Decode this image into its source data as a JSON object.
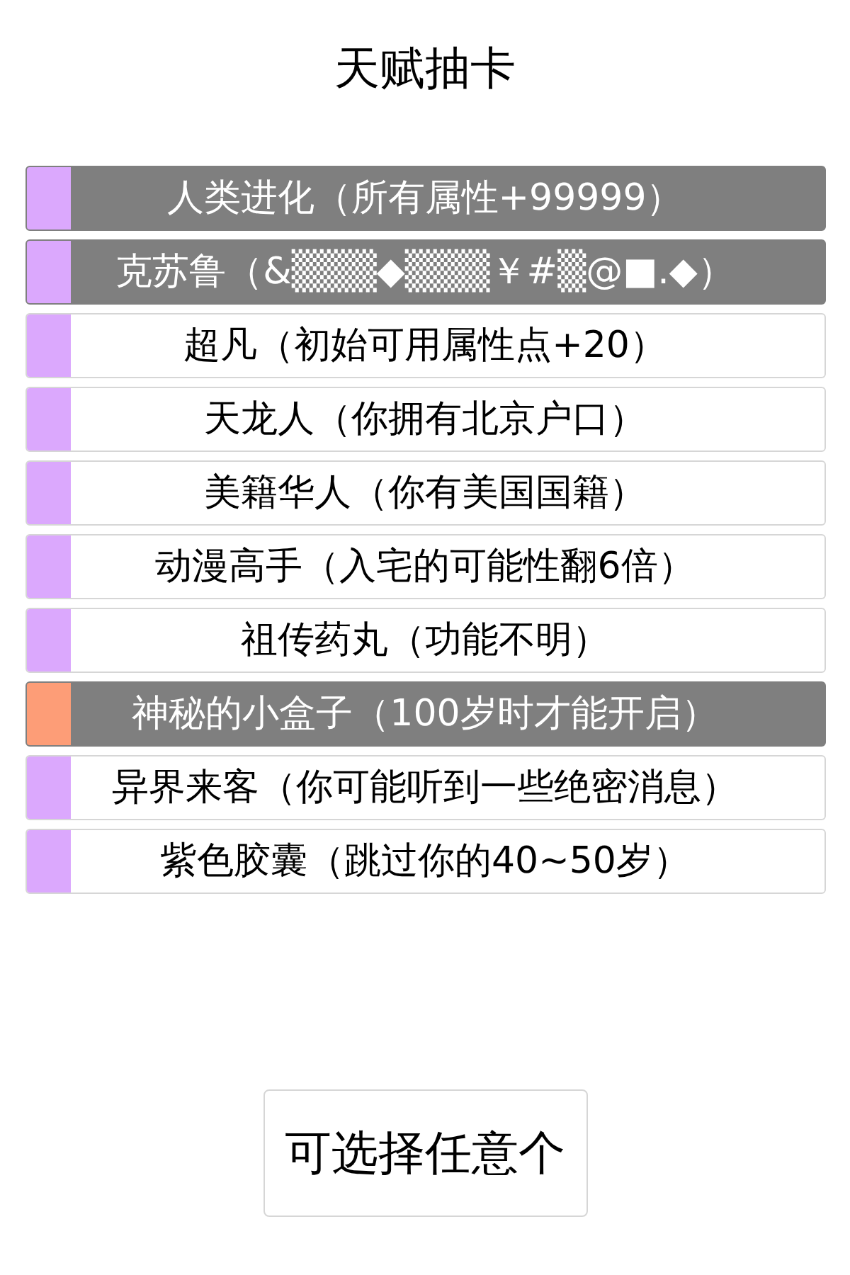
{
  "title": "天赋抽卡",
  "talents": [
    {
      "label": "人类进化（所有属性+99999）",
      "selected": true,
      "color": "#dba8fd"
    },
    {
      "label": "克苏鲁（&▒▒▒◆▒▒▒￥#▒@■.◆）",
      "selected": true,
      "color": "#dba8fd"
    },
    {
      "label": "超凡（初始可用属性点+20）",
      "selected": false,
      "color": "#dba8fd"
    },
    {
      "label": "天龙人（你拥有北京户口）",
      "selected": false,
      "color": "#dba8fd"
    },
    {
      "label": "美籍华人（你有美国国籍）",
      "selected": false,
      "color": "#dba8fd"
    },
    {
      "label": "动漫高手（入宅的可能性翻6倍）",
      "selected": false,
      "color": "#dba8fd"
    },
    {
      "label": "祖传药丸（功能不明）",
      "selected": false,
      "color": "#dba8fd"
    },
    {
      "label": "神秘的小盒子（100岁时才能开启）",
      "selected": true,
      "color": "#fd9d77"
    },
    {
      "label": "异界来客（你可能听到一些绝密消息）",
      "selected": false,
      "color": "#dba8fd"
    },
    {
      "label": "紫色胶囊（跳过你的40~50岁）",
      "selected": false,
      "color": "#dba8fd"
    }
  ],
  "button": "可选择任意个"
}
